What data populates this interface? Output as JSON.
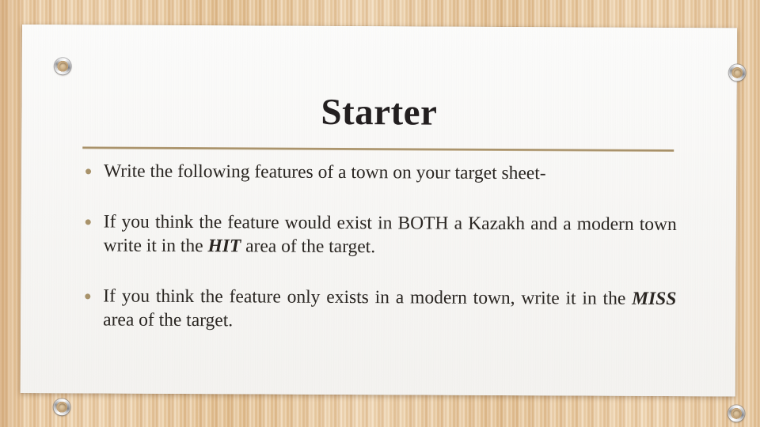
{
  "slide": {
    "title": "Starter",
    "background": {
      "type": "wood-grain",
      "base_color": "#e6c69c",
      "accent_color": "#b9986c"
    },
    "card": {
      "background_color": "#fbfbfa",
      "screws": [
        {
          "name": "screw-top-left"
        },
        {
          "name": "screw-top-right"
        },
        {
          "name": "screw-bottom-left"
        },
        {
          "name": "screw-bottom-right"
        }
      ]
    },
    "divider_color": "#a08a63",
    "bullet_color": "#a8926a",
    "bullets": [
      {
        "id": "bullet-1",
        "parts": [
          {
            "text": "Write the following features of a town on your target sheet-",
            "style": "normal"
          }
        ],
        "plain": "Write the following features of a town on your target sheet-"
      },
      {
        "id": "bullet-2",
        "parts": [
          {
            "text": "If you think the feature would exist in BOTH a Kazakh and a modern town write it in the ",
            "style": "normal"
          },
          {
            "text": "HIT",
            "style": "bold-italic"
          },
          {
            "text": " area of the target.",
            "style": "normal"
          }
        ],
        "plain": "If you think the feature would exist in BOTH a Kazakh and a modern town write it in the HIT area of the target."
      },
      {
        "id": "bullet-3",
        "parts": [
          {
            "text": "If you think the feature only exists in a modern town, write it in the ",
            "style": "normal"
          },
          {
            "text": "MISS",
            "style": "bold-italic"
          },
          {
            "text": " area of the target.",
            "style": "normal"
          }
        ],
        "plain": "If you think the feature only exists in a modern town, write it in the MISS area of the target."
      }
    ]
  }
}
